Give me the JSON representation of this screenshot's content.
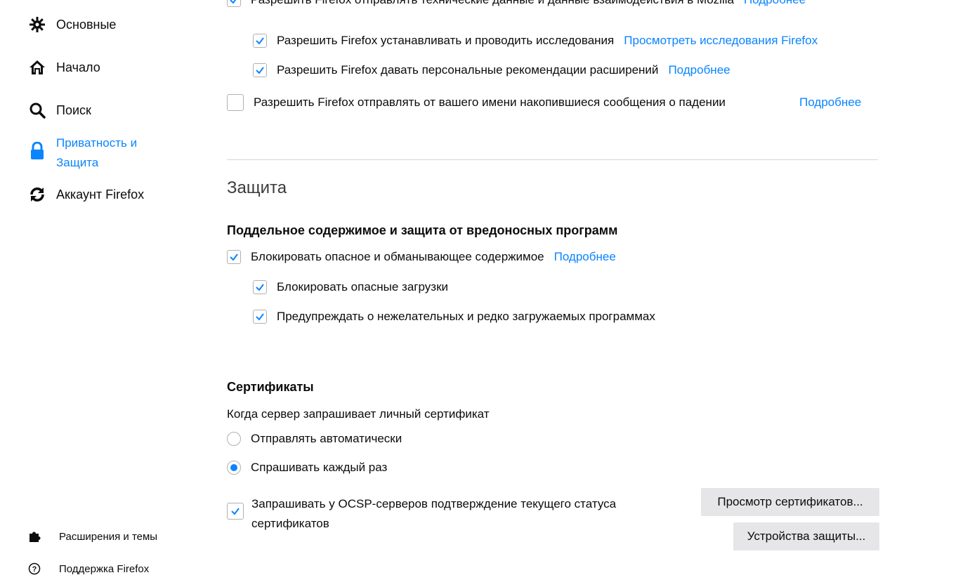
{
  "sidebar": {
    "items": [
      {
        "label": "Основные",
        "icon": "gear-icon"
      },
      {
        "label": "Начало",
        "icon": "home-icon"
      },
      {
        "label": "Поиск",
        "icon": "search-icon"
      },
      {
        "label": "Приватность и\nЗащита",
        "icon": "lock-icon",
        "active": true
      },
      {
        "label": "Аккаунт Firefox",
        "icon": "sync-icon"
      }
    ],
    "footer": [
      {
        "label": "Расширения и темы",
        "icon": "puzzle-icon"
      },
      {
        "label": "Поддержка Firefox",
        "icon": "help-icon"
      }
    ]
  },
  "data_collection": {
    "cut_top": {
      "label": "Разрешить Firefox отправлять технические данные и данные взаимодействия в Mozilla",
      "link": "Подробнее",
      "checked": true
    },
    "studies": {
      "label": "Разрешить Firefox устанавливать и проводить исследования",
      "link": "Просмотреть исследования Firefox",
      "checked": true
    },
    "recommendations": {
      "label": "Разрешить Firefox давать персональные рекомендации расширений",
      "link": "Подробнее",
      "checked": true
    },
    "crash_reports": {
      "label": "Разрешить Firefox отправлять от вашего имени накопившиеся сообщения о падении",
      "link": "Подробнее",
      "checked": false
    }
  },
  "security": {
    "title": "Защита",
    "deceptive": {
      "heading": "Поддельное содержимое и защита от вредоносных программ",
      "block_dangerous": {
        "label": "Блокировать опасное и обманывающее содержимое",
        "link": "Подробнее",
        "checked": true
      },
      "block_downloads": {
        "label": "Блокировать опасные загрузки",
        "checked": true
      },
      "warn_unwanted": {
        "label": "Предупреждать о нежелательных и редко загружаемых программах",
        "checked": true
      }
    },
    "certificates": {
      "heading": "Сертификаты",
      "prompt": "Когда сервер запрашивает личный сертификат",
      "auto": {
        "label": "Отправлять автоматически",
        "selected": false
      },
      "ask": {
        "label": "Спрашивать каждый раз",
        "selected": true
      },
      "ocsp": {
        "label_line1": "Запрашивать у OCSP-серверов подтверждение текущего статуса",
        "label_line2": "сертификатов",
        "checked": true
      },
      "view_button": "Просмотр сертификатов...",
      "devices_button": "Устройства защиты..."
    }
  },
  "colors": {
    "accent": "#0a84ff",
    "text": "#0c0c0d",
    "button_bg": "#e6e6e8"
  }
}
